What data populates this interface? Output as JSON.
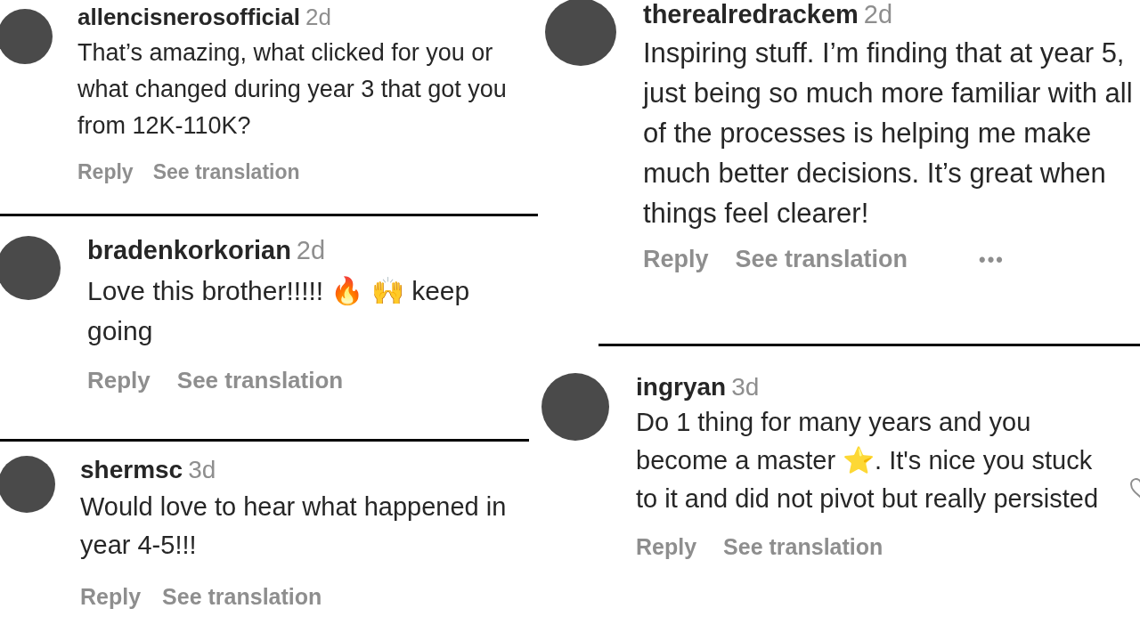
{
  "columns": [
    {
      "comments": [
        {
          "username": "allencisnerosofficial",
          "time": "2d",
          "text": "That’s amazing, what clicked for you or what changed during year 3 that got you from 12K-110K?",
          "actions": [
            "Reply",
            "See translation"
          ]
        },
        {
          "username": "bradenkorkorian",
          "time": "2d",
          "text": "Love this brother!!!!! 🔥 🙌 keep going",
          "actions": [
            "Reply",
            "See translation"
          ]
        },
        {
          "username": "shermsc",
          "time": "3d",
          "text": "Would love to hear what happened in year 4-5!!!",
          "actions": [
            "Reply",
            "See translation"
          ]
        }
      ]
    },
    {
      "comments": [
        {
          "username": "therealredrackem",
          "time": "2d",
          "text": "Inspiring stuff. I’m finding that at year 5, just being so much more familiar with all of the processes is helping me make much better decisions. It’s great when things feel clearer!",
          "actions": [
            "Reply",
            "See translation"
          ],
          "more": "•••"
        },
        {
          "username": "ingryan",
          "time": "3d",
          "text": "Do 1 thing for many years and you become a master ⭐. It's nice you stuck to it and did not pivot but really persisted",
          "actions": [
            "Reply",
            "See translation"
          ],
          "liked": false
        }
      ]
    }
  ]
}
